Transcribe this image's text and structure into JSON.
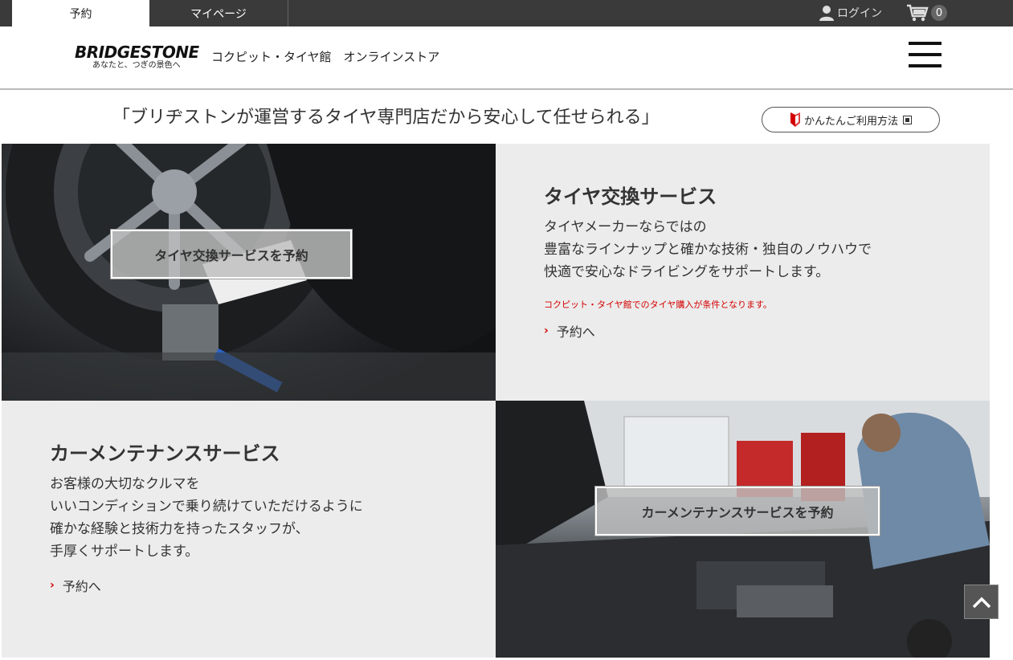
{
  "topbar": {
    "tabs": [
      {
        "label": "予約"
      },
      {
        "label": "マイページ"
      }
    ],
    "login_label": "ログイン",
    "cart_count": "0"
  },
  "header": {
    "logo_main": "BRIDGESTONE",
    "logo_sub": "あなたと、つぎの景色へ",
    "site_title": "コクピット・タイヤ館　オンラインストア"
  },
  "tagline": "「ブリヂストンが運営するタイヤ専門店だから安心して任せられる」",
  "howto_label": "かんたんご利用方法",
  "services": {
    "tire": {
      "button_label": "タイヤ交換サービスを予約",
      "title": "タイヤ交換サービス",
      "desc_lines": [
        "タイヤメーカーならではの",
        "豊富なラインナップと確かな技術・独自のノウハウで",
        "快適で安心なドライビングをサポートします。"
      ],
      "note": "コクピット・タイヤ館でのタイヤ購入が条件となります。",
      "link_label": "予約へ"
    },
    "maintenance": {
      "button_label": "カーメンテナンスサービスを予約",
      "title": "カーメンテナンスサービス",
      "desc_lines": [
        "お客様の大切なクルマを",
        "いいコンディションで乗り続けていただけるように",
        "確かな経験と技術力を持ったスタッフが、",
        "手厚くサポートします。"
      ],
      "link_label": "予約へ"
    }
  },
  "icons": {
    "user": "user-icon",
    "cart": "cart-icon",
    "menu": "hamburger-icon",
    "flag": "beginner-mark-icon",
    "external": "external-window-icon",
    "chevron": "chevron-right-icon",
    "to_top": "chevron-up-icon"
  },
  "colors": {
    "topbar": "#3a3a3a",
    "accent_red": "#d40000",
    "panel_bg": "#ececec"
  }
}
